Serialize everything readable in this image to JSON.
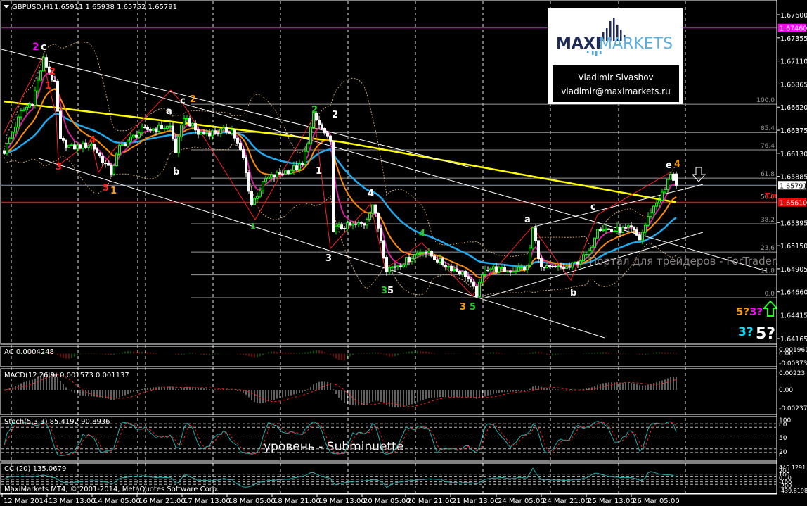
{
  "header": {
    "menu_icon": "triangle-down-icon",
    "symbol": "GBPUSD,H1",
    "ohlc": "1.65911 1.65938 1.65752 1.65791"
  },
  "logo": {
    "brand_left": "MAXI",
    "brand_right": "MARKETS",
    "author": "Vladimir Sivashov",
    "email": "vladimir@maximarkets.ru"
  },
  "watermark": "Портал для трейдеров - ForTrader.ru",
  "note": "уровень - Subminuette",
  "copyright": "MaxiMarkets MT4, © 2001-2014, MetaQuotes Software Corp.",
  "colors": {
    "bull": "#00ff00",
    "bear": "#ffffff",
    "ma_fast": "#d0209a",
    "ma_mid": "#ff8c00",
    "ma_slow": "#1eaaf0",
    "ma_long": "#ffff00",
    "support": "#ff0000",
    "resistance": "#ff00ff",
    "grid": "#ffffff",
    "fib": "#9a9a9a"
  },
  "price_axis": {
    "ticks": [
      "1.67600",
      "1.67355",
      "1.67110",
      "1.66865",
      "1.66620",
      "1.66375",
      "1.66130",
      "1.65885",
      "1.65395",
      "1.65150",
      "1.64905",
      "1.64660",
      "1.64415",
      "1.64165"
    ],
    "tag_resistance": "1.67460",
    "tag_bid": "1.65791",
    "tag_support": "1.65610"
  },
  "fib_labels": [
    "100.0",
    "85.4",
    "76.4",
    "61.8",
    "50.0",
    "38.2",
    "23.6",
    "11.8",
    "0.0"
  ],
  "wave_labels": [
    {
      "text": "2",
      "color": "#ff00ff"
    },
    {
      "text": "c",
      "color": "#ffffff"
    },
    {
      "text": "2",
      "color": "#ff2020"
    },
    {
      "text": "1",
      "color": "#ff2020"
    },
    {
      "text": "3",
      "color": "#ff2020"
    },
    {
      "text": "4",
      "color": "#ff2020"
    },
    {
      "text": "5",
      "color": "#ff2020"
    },
    {
      "text": "1",
      "color": "#ff9900"
    },
    {
      "text": "a",
      "color": "#ffffff"
    },
    {
      "text": "c",
      "color": "#ffffff"
    },
    {
      "text": "2",
      "color": "#ff9900"
    },
    {
      "text": "b",
      "color": "#ffffff"
    },
    {
      "text": "1",
      "color": "#20d020"
    },
    {
      "text": "2",
      "color": "#20d020"
    },
    {
      "text": "2",
      "color": "#ffffff"
    },
    {
      "text": "1",
      "color": "#ffffff"
    },
    {
      "text": "4",
      "color": "#ffffff"
    },
    {
      "text": "3",
      "color": "#ffffff"
    },
    {
      "text": "4",
      "color": "#20d020"
    },
    {
      "text": "3",
      "color": "#20d020"
    },
    {
      "text": "5",
      "color": "#ffffff"
    },
    {
      "text": "3",
      "color": "#ff9900"
    },
    {
      "text": "5",
      "color": "#20d020"
    },
    {
      "text": "a",
      "color": "#ffffff"
    },
    {
      "text": "c",
      "color": "#ffffff"
    },
    {
      "text": "b",
      "color": "#ffffff"
    },
    {
      "text": "e",
      "color": "#ffffff"
    },
    {
      "text": "4",
      "color": "#ff9900"
    },
    {
      "text": "T.n",
      "color": "#ff0000"
    },
    {
      "text": "5?",
      "color": "#ff9900"
    },
    {
      "text": "3?",
      "color": "#ff00ff"
    },
    {
      "text": "3?",
      "color": "#00e0ff"
    },
    {
      "text": "5?",
      "color": "#ffffff"
    }
  ],
  "arrows": {
    "down": "arrow-down-outline-icon",
    "up": "arrow-up-green-icon"
  },
  "indicators": {
    "ac": {
      "label": "AC 0.0004248",
      "axis": [
        "0.001961",
        "0.00",
        "-0.003734"
      ]
    },
    "macd": {
      "label": "MACD(12,26,9) 0.001573 0.001137",
      "axis": [
        "0.00223",
        "0.00",
        "-0.002377"
      ]
    },
    "stoch": {
      "label": "Stoch(5,3,3) 85.4192 90.8936",
      "axis": [
        "100",
        "80",
        "50",
        "20",
        "0"
      ]
    },
    "cci": {
      "label": "CCI(20) 135.0679",
      "axis": [
        "446.1291",
        "200",
        "100",
        "0.00",
        "-100",
        "-200",
        "-439.8198"
      ]
    }
  },
  "time_labels": [
    "12 Mar 2014",
    "13 Mar 13:00",
    "14 Mar 05:00",
    "16 Mar 21:00",
    "17 Mar 13:00",
    "18 Mar 05:00",
    "18 Mar 21:00",
    "19 Mar 13:00",
    "20 Mar 05:00",
    "20 Mar 21:00",
    "21 Mar 13:00",
    "24 Mar 05:00",
    "24 Mar 21:00",
    "25 Mar 13:00",
    "26 Mar 05:00"
  ],
  "chart_data": {
    "type": "candlestick",
    "title": "GBPUSD,H1",
    "timeframe": "H1",
    "last_bar": {
      "open": 1.65911,
      "high": 1.65938,
      "low": 1.65752,
      "close": 1.65791
    },
    "ylim": [
      1.641,
      1.6765
    ],
    "resistance_level": 1.6746,
    "support_level": 1.6561,
    "bid": 1.65791,
    "fib": {
      "high": 1.66651,
      "low": 1.64598,
      "levels": [
        1.0,
        0.854,
        0.764,
        0.618,
        0.5,
        0.382,
        0.236,
        0.118,
        0.0
      ]
    },
    "bars": 240,
    "close_path": [
      [
        0,
        1.66151
      ],
      [
        6,
        1.66562
      ],
      [
        10,
        1.66674
      ],
      [
        14,
        1.67122
      ],
      [
        18,
        1.66861
      ],
      [
        20,
        1.66263
      ],
      [
        24,
        1.66189
      ],
      [
        31,
        1.66226
      ],
      [
        38,
        1.65927
      ],
      [
        41,
        1.66189
      ],
      [
        49,
        1.66375
      ],
      [
        59,
        1.66413
      ],
      [
        61,
        1.66151
      ],
      [
        64,
        1.66525
      ],
      [
        69,
        1.66338
      ],
      [
        81,
        1.66375
      ],
      [
        85,
        1.66077
      ],
      [
        88,
        1.65591
      ],
      [
        93,
        1.65853
      ],
      [
        99,
        1.65927
      ],
      [
        106,
        1.66002
      ],
      [
        110,
        1.66525
      ],
      [
        114,
        1.66338
      ],
      [
        116,
        1.66226
      ],
      [
        117,
        1.6533
      ],
      [
        121,
        1.65352
      ],
      [
        128,
        1.65382
      ],
      [
        131,
        1.65591
      ],
      [
        134,
        1.65218
      ],
      [
        136,
        1.64904
      ],
      [
        141,
        1.64957
      ],
      [
        149,
        1.65106
      ],
      [
        156,
        1.64957
      ],
      [
        164,
        1.64845
      ],
      [
        168,
        1.64636
      ],
      [
        171,
        1.64919
      ],
      [
        179,
        1.64882
      ],
      [
        186,
        1.64919
      ],
      [
        188,
        1.6533
      ],
      [
        191,
        1.64904
      ],
      [
        201,
        1.64919
      ],
      [
        208,
        1.65069
      ],
      [
        211,
        1.65352
      ],
      [
        216,
        1.65308
      ],
      [
        223,
        1.6533
      ],
      [
        226,
        1.65218
      ],
      [
        230,
        1.65517
      ],
      [
        235,
        1.65741
      ],
      [
        237,
        1.65927
      ],
      [
        239,
        1.65791
      ]
    ],
    "ma_long_path": [
      [
        0,
        1.6668
      ],
      [
        120,
        1.6625
      ],
      [
        239,
        1.6561
      ]
    ],
    "stoch_last": [
      85.4192,
      90.8936
    ],
    "macd_last": [
      0.001573,
      0.001137
    ],
    "ac_last": 0.0004248,
    "cci_last": 135.0679
  }
}
